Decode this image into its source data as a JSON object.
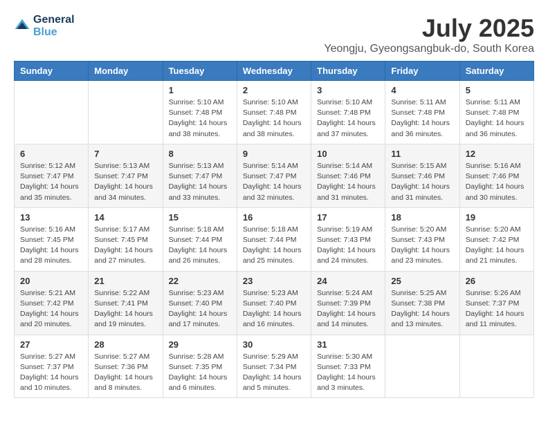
{
  "header": {
    "logo_line1": "General",
    "logo_line2": "Blue",
    "month": "July 2025",
    "location": "Yeongju, Gyeongsangbuk-do, South Korea"
  },
  "days_of_week": [
    "Sunday",
    "Monday",
    "Tuesday",
    "Wednesday",
    "Thursday",
    "Friday",
    "Saturday"
  ],
  "weeks": [
    [
      {
        "day": "",
        "info": ""
      },
      {
        "day": "",
        "info": ""
      },
      {
        "day": "1",
        "info": "Sunrise: 5:10 AM\nSunset: 7:48 PM\nDaylight: 14 hours\nand 38 minutes."
      },
      {
        "day": "2",
        "info": "Sunrise: 5:10 AM\nSunset: 7:48 PM\nDaylight: 14 hours\nand 38 minutes."
      },
      {
        "day": "3",
        "info": "Sunrise: 5:10 AM\nSunset: 7:48 PM\nDaylight: 14 hours\nand 37 minutes."
      },
      {
        "day": "4",
        "info": "Sunrise: 5:11 AM\nSunset: 7:48 PM\nDaylight: 14 hours\nand 36 minutes."
      },
      {
        "day": "5",
        "info": "Sunrise: 5:11 AM\nSunset: 7:48 PM\nDaylight: 14 hours\nand 36 minutes."
      }
    ],
    [
      {
        "day": "6",
        "info": "Sunrise: 5:12 AM\nSunset: 7:47 PM\nDaylight: 14 hours\nand 35 minutes."
      },
      {
        "day": "7",
        "info": "Sunrise: 5:13 AM\nSunset: 7:47 PM\nDaylight: 14 hours\nand 34 minutes."
      },
      {
        "day": "8",
        "info": "Sunrise: 5:13 AM\nSunset: 7:47 PM\nDaylight: 14 hours\nand 33 minutes."
      },
      {
        "day": "9",
        "info": "Sunrise: 5:14 AM\nSunset: 7:47 PM\nDaylight: 14 hours\nand 32 minutes."
      },
      {
        "day": "10",
        "info": "Sunrise: 5:14 AM\nSunset: 7:46 PM\nDaylight: 14 hours\nand 31 minutes."
      },
      {
        "day": "11",
        "info": "Sunrise: 5:15 AM\nSunset: 7:46 PM\nDaylight: 14 hours\nand 31 minutes."
      },
      {
        "day": "12",
        "info": "Sunrise: 5:16 AM\nSunset: 7:46 PM\nDaylight: 14 hours\nand 30 minutes."
      }
    ],
    [
      {
        "day": "13",
        "info": "Sunrise: 5:16 AM\nSunset: 7:45 PM\nDaylight: 14 hours\nand 28 minutes."
      },
      {
        "day": "14",
        "info": "Sunrise: 5:17 AM\nSunset: 7:45 PM\nDaylight: 14 hours\nand 27 minutes."
      },
      {
        "day": "15",
        "info": "Sunrise: 5:18 AM\nSunset: 7:44 PM\nDaylight: 14 hours\nand 26 minutes."
      },
      {
        "day": "16",
        "info": "Sunrise: 5:18 AM\nSunset: 7:44 PM\nDaylight: 14 hours\nand 25 minutes."
      },
      {
        "day": "17",
        "info": "Sunrise: 5:19 AM\nSunset: 7:43 PM\nDaylight: 14 hours\nand 24 minutes."
      },
      {
        "day": "18",
        "info": "Sunrise: 5:20 AM\nSunset: 7:43 PM\nDaylight: 14 hours\nand 23 minutes."
      },
      {
        "day": "19",
        "info": "Sunrise: 5:20 AM\nSunset: 7:42 PM\nDaylight: 14 hours\nand 21 minutes."
      }
    ],
    [
      {
        "day": "20",
        "info": "Sunrise: 5:21 AM\nSunset: 7:42 PM\nDaylight: 14 hours\nand 20 minutes."
      },
      {
        "day": "21",
        "info": "Sunrise: 5:22 AM\nSunset: 7:41 PM\nDaylight: 14 hours\nand 19 minutes."
      },
      {
        "day": "22",
        "info": "Sunrise: 5:23 AM\nSunset: 7:40 PM\nDaylight: 14 hours\nand 17 minutes."
      },
      {
        "day": "23",
        "info": "Sunrise: 5:23 AM\nSunset: 7:40 PM\nDaylight: 14 hours\nand 16 minutes."
      },
      {
        "day": "24",
        "info": "Sunrise: 5:24 AM\nSunset: 7:39 PM\nDaylight: 14 hours\nand 14 minutes."
      },
      {
        "day": "25",
        "info": "Sunrise: 5:25 AM\nSunset: 7:38 PM\nDaylight: 14 hours\nand 13 minutes."
      },
      {
        "day": "26",
        "info": "Sunrise: 5:26 AM\nSunset: 7:37 PM\nDaylight: 14 hours\nand 11 minutes."
      }
    ],
    [
      {
        "day": "27",
        "info": "Sunrise: 5:27 AM\nSunset: 7:37 PM\nDaylight: 14 hours\nand 10 minutes."
      },
      {
        "day": "28",
        "info": "Sunrise: 5:27 AM\nSunset: 7:36 PM\nDaylight: 14 hours\nand 8 minutes."
      },
      {
        "day": "29",
        "info": "Sunrise: 5:28 AM\nSunset: 7:35 PM\nDaylight: 14 hours\nand 6 minutes."
      },
      {
        "day": "30",
        "info": "Sunrise: 5:29 AM\nSunset: 7:34 PM\nDaylight: 14 hours\nand 5 minutes."
      },
      {
        "day": "31",
        "info": "Sunrise: 5:30 AM\nSunset: 7:33 PM\nDaylight: 14 hours\nand 3 minutes."
      },
      {
        "day": "",
        "info": ""
      },
      {
        "day": "",
        "info": ""
      }
    ]
  ]
}
